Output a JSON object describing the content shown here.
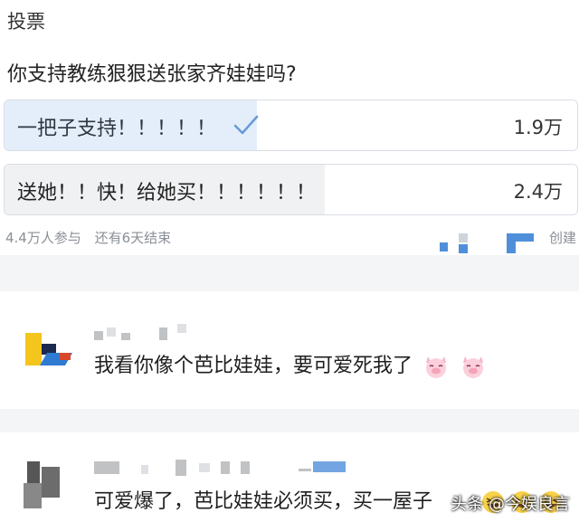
{
  "poll": {
    "header": "投票",
    "question": "你支持教练狠狠送张家齐娃娃吗?",
    "options": [
      {
        "label": "一把子支持！！！！！",
        "count": "1.9万",
        "share": 0.44,
        "selected": true
      },
      {
        "label": "送她！！快！给她买！！！！！！",
        "count": "2.4万",
        "share": 0.56,
        "selected": false
      }
    ],
    "participants": "4.4万人参与",
    "remaining": "还有6天结束",
    "creator_label": "创建"
  },
  "comments": [
    {
      "text": "我看你像个芭比娃娃，要可爱死我了",
      "emoji": "pig-face-icon",
      "emoji_count": 2
    },
    {
      "text": "可爱爆了，芭比娃娃必须买，买一屋子",
      "emoji": "laughing-face-icon",
      "emoji_count": 3
    }
  ],
  "watermark": "头条 @今娱良言",
  "colors": {
    "selected_fill": "#e4eefb",
    "check": "#6a9ad8",
    "blue_pixel": "#4f8fd9"
  }
}
